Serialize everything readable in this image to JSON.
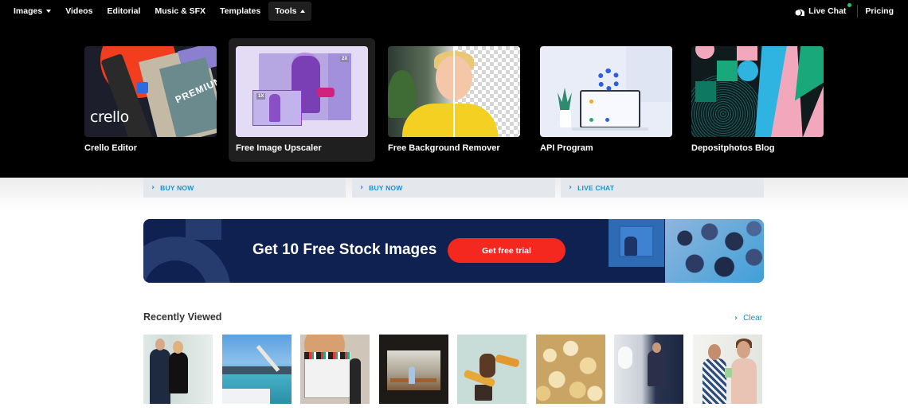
{
  "nav": {
    "items": [
      {
        "label": "Images",
        "has_caret": "down"
      },
      {
        "label": "Videos"
      },
      {
        "label": "Editorial"
      },
      {
        "label": "Music & SFX"
      },
      {
        "label": "Templates"
      },
      {
        "label": "Tools",
        "has_caret": "up",
        "active": true
      }
    ],
    "live_chat": "Live Chat",
    "live_chat_status_color": "#22c55e",
    "pricing": "Pricing"
  },
  "tools_menu": {
    "cards": [
      {
        "label": "Crello Editor",
        "image": "crello-promo-image",
        "image_text": [
          "crello",
          "PREMIUM"
        ]
      },
      {
        "label": "Free Image Upscaler",
        "image": "upscaler-promo-image",
        "image_text": [
          "2X",
          "1X"
        ],
        "active": true
      },
      {
        "label": "Free Background Remover",
        "image": "background-remover-promo-image"
      },
      {
        "label": "API Program",
        "image": "api-program-illustration"
      },
      {
        "label": "Depositphotos Blog",
        "image": "blog-abstract-art"
      }
    ]
  },
  "support_links": [
    {
      "label": "BUY NOW"
    },
    {
      "label": "BUY NOW"
    },
    {
      "label": "LIVE CHAT"
    }
  ],
  "banner": {
    "headline": "Get 10 Free Stock Images",
    "cta": "Get free trial",
    "accent_color": "#f5281f",
    "background_color": "#0f2150"
  },
  "recently_viewed": {
    "title": "Recently Viewed",
    "clear_label": "Clear",
    "items": [
      {
        "alt": "business couple in office"
      },
      {
        "alt": "seaport with crane and ships"
      },
      {
        "alt": "film clapperboard on set"
      },
      {
        "alt": "woman on subway platform bench"
      },
      {
        "alt": "retro women sitting on tv"
      },
      {
        "alt": "popcorn closeup"
      },
      {
        "alt": "man using phone on airplane"
      },
      {
        "alt": "couple looking at smartphone"
      }
    ]
  },
  "colors": {
    "link_blue": "#1a8fd5",
    "nav_bg": "#000000"
  }
}
